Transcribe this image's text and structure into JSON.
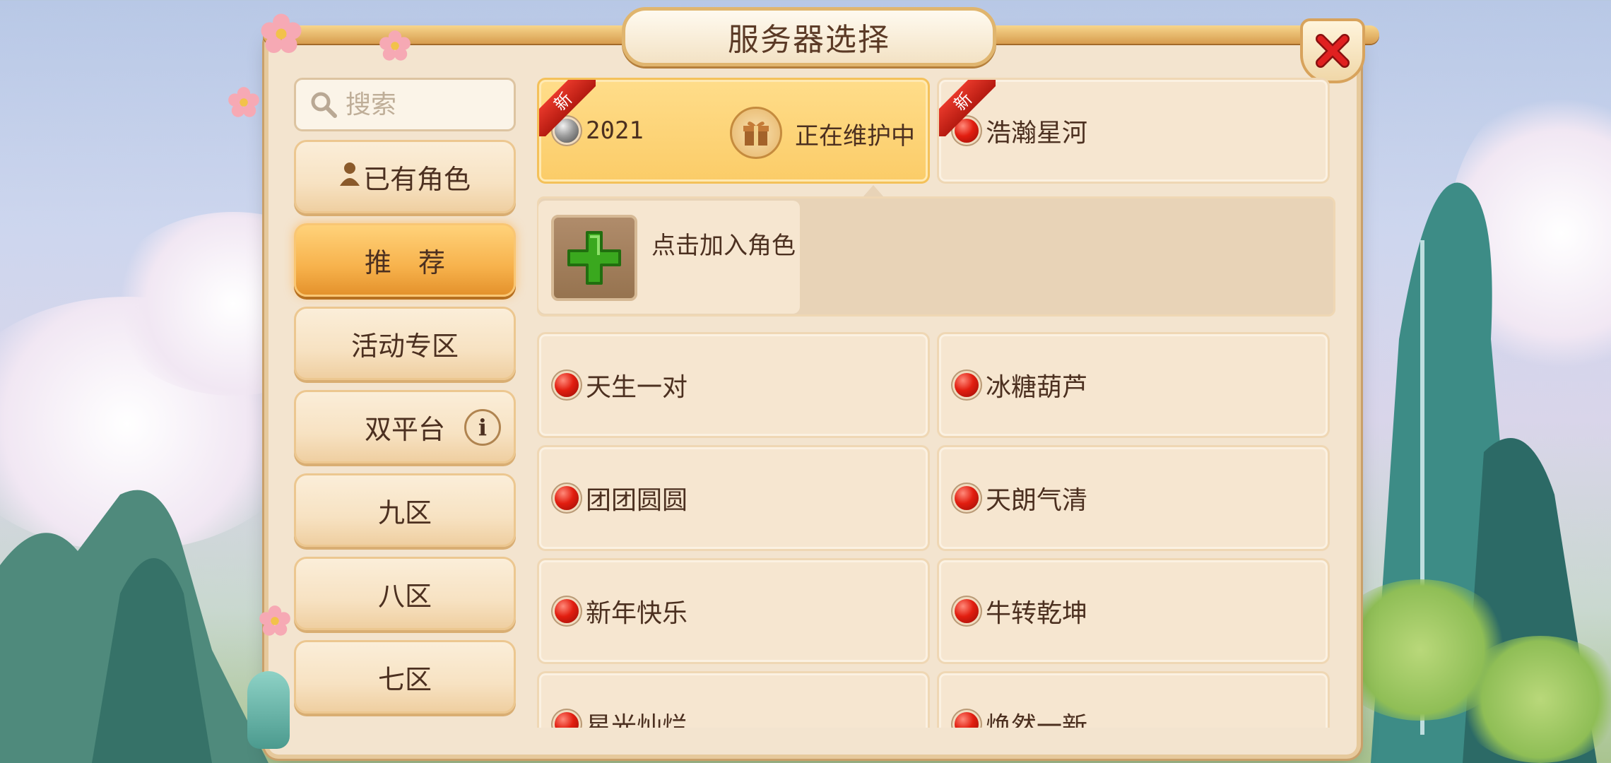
{
  "window": {
    "title": "服务器选择"
  },
  "search": {
    "placeholder": "搜索",
    "value": ""
  },
  "sidebar": {
    "items": [
      {
        "label": "已有角色",
        "icon": "person-icon",
        "active": false
      },
      {
        "label": "推　荐",
        "active": true
      },
      {
        "label": "活动专区",
        "active": false
      },
      {
        "label": "双平台",
        "icon": "info-icon",
        "active": false
      },
      {
        "label": "九区",
        "active": false
      },
      {
        "label": "八区",
        "active": false
      },
      {
        "label": "七区",
        "active": false
      }
    ]
  },
  "featured": [
    {
      "name": "2021",
      "status": "正在维护中",
      "badge": "新",
      "dot": "gray",
      "icon": "gift-icon",
      "selected": true
    },
    {
      "name": "浩瀚星河",
      "badge": "新",
      "dot": "red",
      "selected": false
    }
  ],
  "join": {
    "label": "点击加入角色",
    "icon": "plus-icon"
  },
  "servers": [
    {
      "name": "天生一对",
      "dot": "red"
    },
    {
      "name": "冰糖葫芦",
      "dot": "red"
    },
    {
      "name": "团团圆圆",
      "dot": "red"
    },
    {
      "name": "天朗气清",
      "dot": "red"
    },
    {
      "name": "新年快乐",
      "dot": "red"
    },
    {
      "name": "牛转乾坤",
      "dot": "red"
    },
    {
      "name": "星光灿烂",
      "dot": "red"
    },
    {
      "name": "焕然一新",
      "dot": "red"
    }
  ],
  "colors": {
    "accent": "#f7b24c",
    "panel": "#f3e4cf",
    "status_dot": "#e21e10",
    "close": "#e02020"
  }
}
